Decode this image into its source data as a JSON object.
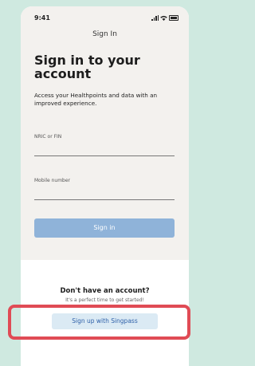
{
  "status_bar": {
    "time": "9:41"
  },
  "nav": {
    "title": "Sign In"
  },
  "main": {
    "heading": "Sign in to your account",
    "subtitle": "Access your Healthpoints and data with an improved experience.",
    "nric_label": "NRIC or FIN",
    "nric_value": "",
    "mobile_label": "Mobile number",
    "mobile_value": "",
    "signin_label": "Sign in"
  },
  "footer": {
    "title": "Don't have an account?",
    "subtitle": "It's a perfect time to get started!",
    "singpass_label": "Sign up with Singpass"
  },
  "colors": {
    "page_bg": "#cfe9e0",
    "card_top_bg": "#f3f1ee",
    "signin_button": "#8fb3d9",
    "singpass_button_bg": "#dbeaf4",
    "singpass_text": "#2d5fa8",
    "highlight": "#e04b55"
  },
  "icons": [
    "signal-icon",
    "wifi-icon",
    "battery-icon"
  ]
}
